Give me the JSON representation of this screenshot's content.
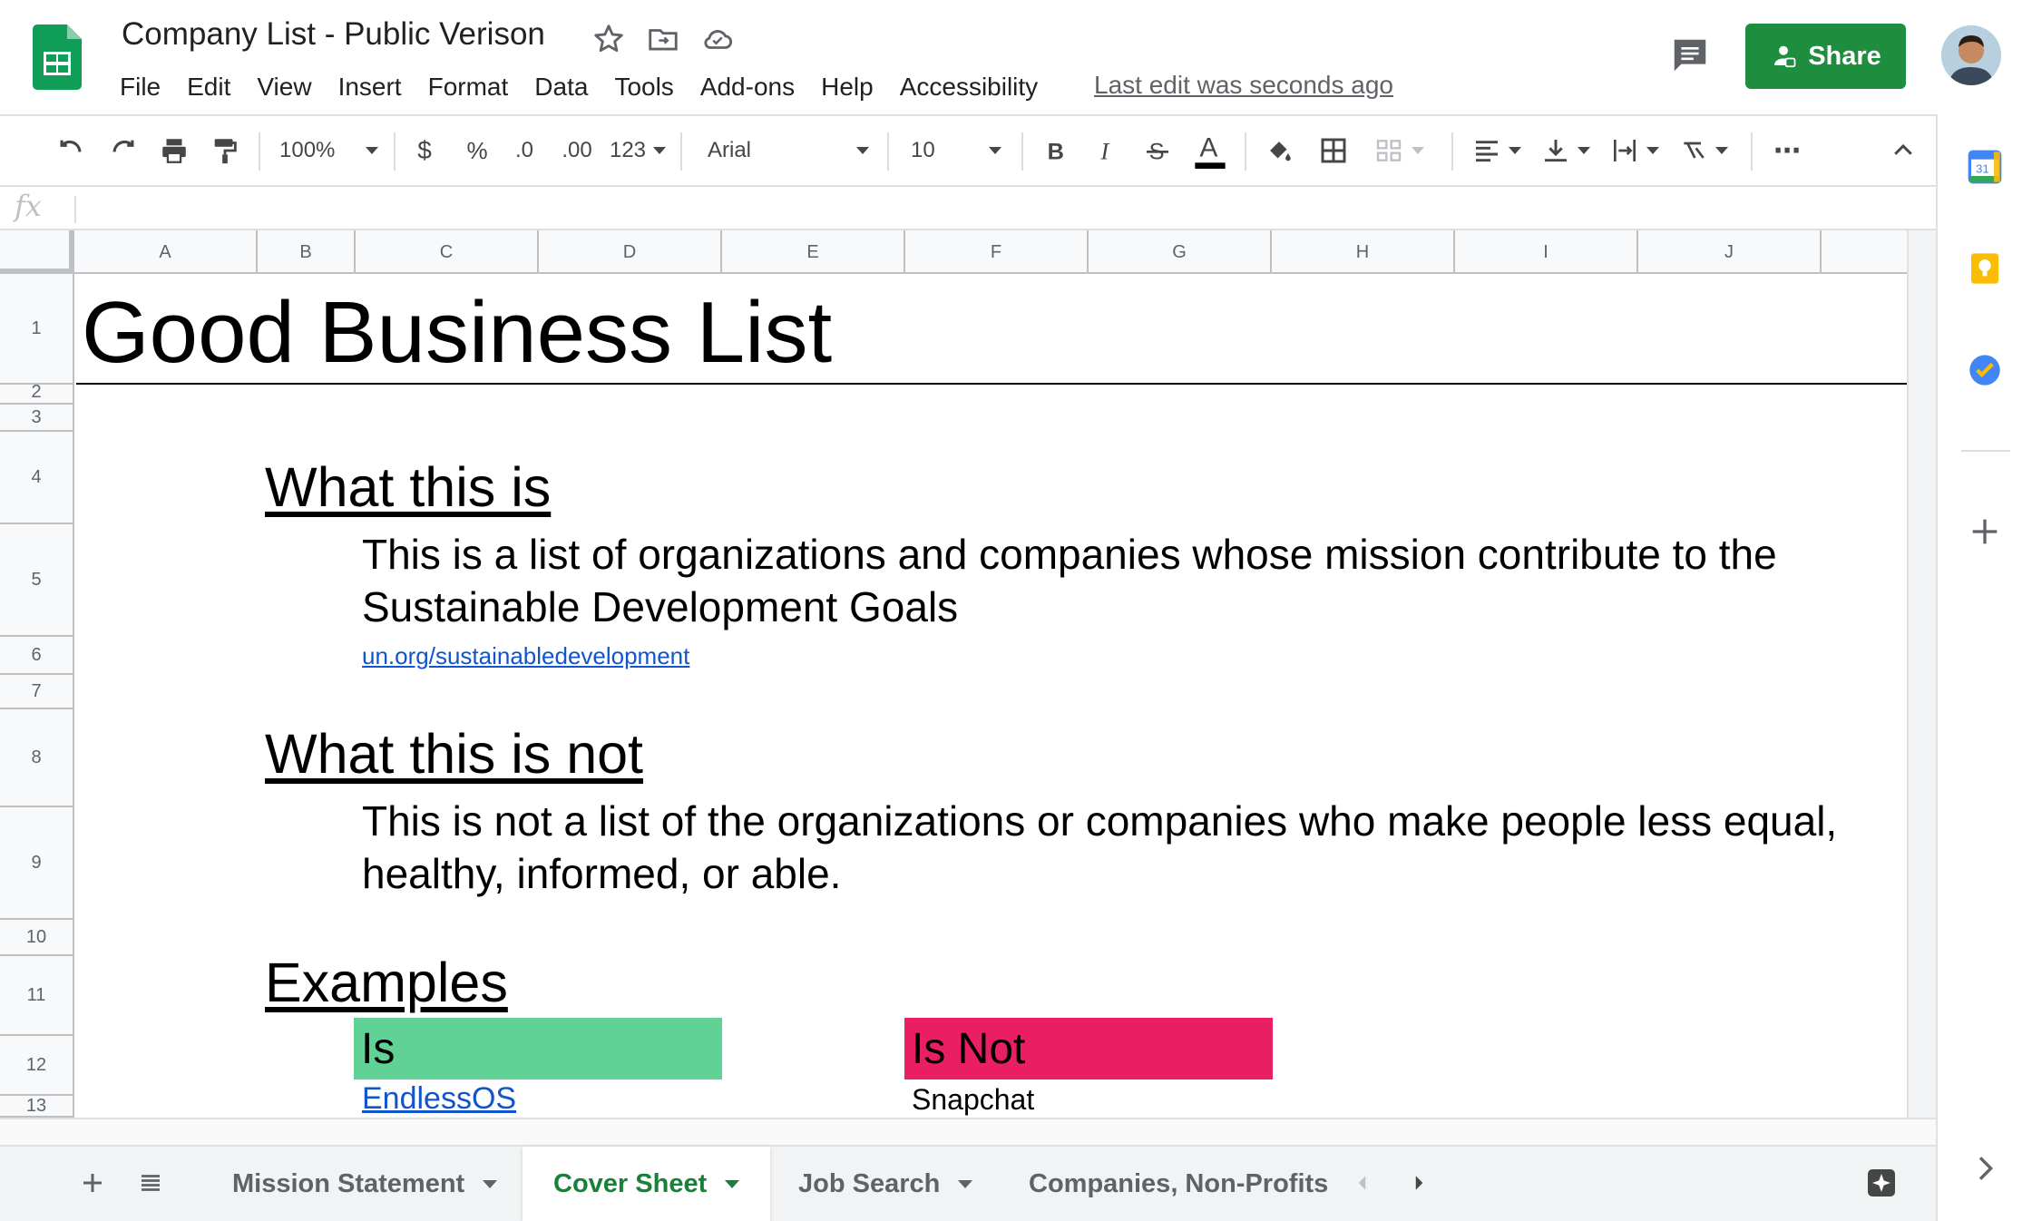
{
  "app": {
    "document_title": "Company List - Public Verison",
    "menu": [
      "File",
      "Edit",
      "View",
      "Insert",
      "Format",
      "Data",
      "Tools",
      "Add-ons",
      "Help",
      "Accessibility"
    ],
    "last_edit": "Last edit was seconds ago",
    "share_label": "Share",
    "brand_color": "#1e8e3e"
  },
  "toolbar": {
    "zoom": "100%",
    "currency": "$",
    "percent": "%",
    "decrease_decimals": ".0",
    "increase_decimals": ".00",
    "more_formats": "123",
    "font": "Arial",
    "font_size": "10",
    "more": "⋯"
  },
  "grid": {
    "columns": [
      "A",
      "B",
      "C",
      "D",
      "E",
      "F",
      "G",
      "H",
      "I",
      "J"
    ],
    "rows": [
      "1",
      "2",
      "3",
      "4",
      "5",
      "6",
      "7",
      "8",
      "9",
      "10",
      "11",
      "12",
      "13"
    ]
  },
  "content": {
    "title": "Good Business List",
    "what_heading": "What this is",
    "what_text": "This is a list of organizations and companies whose mission contribute to the Sustainable Development Goals",
    "what_link": "un.org/sustainabledevelopment",
    "not_heading": "What this is not",
    "not_text": "This is not a list of the organizations or companies who make people less equal, healthy, informed, or able.",
    "examples_heading": "Examples",
    "is_label": "Is",
    "is_color": "#61d295",
    "isnot_label": "Is Not",
    "isnot_color": "#e91e63",
    "is_example": "EndlessOS",
    "isnot_example": "Snapchat"
  },
  "sheets": {
    "tabs": [
      "Mission Statement",
      "Cover Sheet",
      "Job Search",
      "Companies, Non-Profits"
    ],
    "active": "Cover Sheet"
  }
}
